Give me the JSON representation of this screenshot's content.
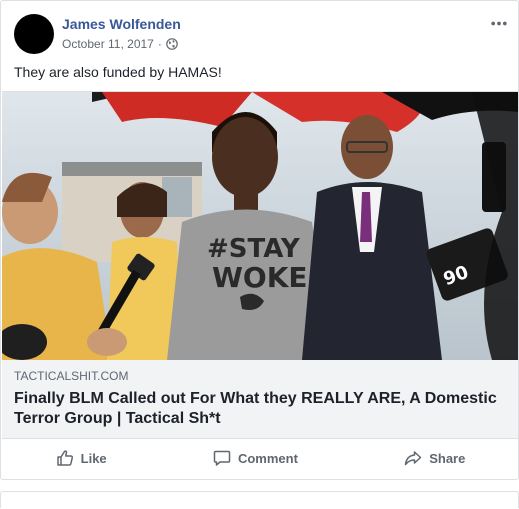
{
  "post": {
    "author": "James Wolfenden",
    "date": "October 11, 2017",
    "separator": "·",
    "privacy_icon": "globe-icon",
    "menu_icon": "more-options-icon",
    "text": "They are also funded by HAMAS!"
  },
  "link_preview": {
    "image": "photo-protest-stay-woke",
    "domain": "TACTICALSHIT.COM",
    "headline": "Finally BLM Called out For What they REALLY ARE, A Domestic Terror Group | Tactical Sh*t"
  },
  "actions": {
    "like_label": "Like",
    "like_icon": "thumbs-up-icon",
    "comment_label": "Comment",
    "comment_icon": "speech-bubble-icon",
    "share_label": "Share",
    "share_icon": "share-arrow-icon"
  },
  "colors": {
    "author_link": "#385898",
    "secondary_text": "#606770",
    "border": "#dddfe2",
    "link_card_bg": "#f2f3f5"
  }
}
